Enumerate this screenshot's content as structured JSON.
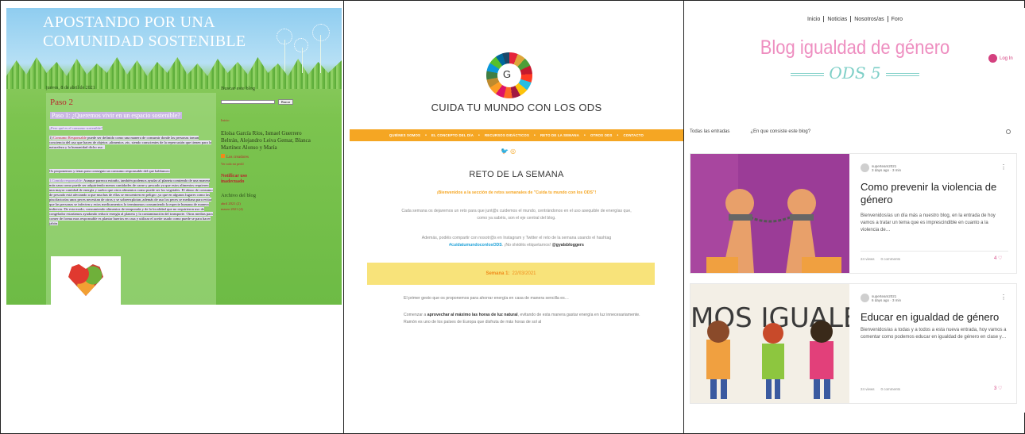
{
  "panel1": {
    "blog_title": "APOSTANDO POR UNA COMUNIDAD SOSTENIBLE",
    "date": "jueves, 8 de abril de 2021",
    "post_title": "Paso 2",
    "post_subtitle": "Paso 1: ¿Queremos vivir en un espacio sostenible?",
    "question": "¿Pero qué es el consumo sostenible?",
    "p1_label": "1)",
    "p1_red": "Consumo Responsable",
    "p1_text": "puede ser definido como una manera de consumir donde las personas toman conciencia del uso que hacen de objetos ,alimentos ,etc, siendo conscientes de la repercusión que tienen para la naturaleza y la humanidad dicho uso .",
    "p2_text": "Os proponemos y tenas para conseguir un consumo responsable del que hablamos:",
    "p3_red": "1.Comida responsable:",
    "p3_text": "Aunque parezca extraño, también podemos ayudar al planeta comiendo de una manera más sana como puede ser adquiriendo menos cantidades de carne y pescado ya que estos alimentos requieren una mayor cantidad de energía y suelos que otros alimentos como puede ser los vegetales. El abuso de consumo de pescado está afectando a que muchas de ellas se encuentren en peligro ,ya que en algunos lugares como las piscifactorías unos peces necesitan de otros y se sobreexplotan ,además de uso los peces se mediana para evitar que las personas se infecten y estos medicamentos lo terminamos consumiendo la especie humana de manera indirecta. De esta modo, consumiendo alimentos de temporada y de la localidad que no requirieron uso de congelador estaríamos ayudando reducir energía al planeta y la contaminación del transporte. Otras medias para comer de forma mas responsable es plantar huertos en casa y utilizar el aceite usado como puede se para hacer jabón.",
    "sidebar": {
      "search_heading": "Buscar este blog",
      "search_button": "Buscar",
      "home_link": "Inicio",
      "authors": "Eloísa García Ríos, Ismael Guerrero Beltrán, Alejandro Leiva Gemar, Blanca Martínez Alonso y María",
      "creators_link": "Los creadores",
      "profile_link": "Ver todo mi perfil",
      "notify_heading": "Notificar uso inadecuado",
      "archive_heading": "Archivo del blog",
      "archive_items": [
        "abril 2021 (2)",
        "marzo 2021 (4)"
      ]
    }
  },
  "panel2": {
    "logo_letter": "G",
    "brand": "CUIDA TU MUNDO CON LOS ODS",
    "nav": [
      "QUIÉNES SOMOS",
      "EL CONCEPTO DEL DÍA",
      "RECURSOS DIDÁCTICOS",
      "RETO DE LA SEMANA",
      "OTROS ODS",
      "CONTACTO"
    ],
    "nav_sep": "•",
    "social": "🐦 ◎",
    "heading": "RETO DE LA SEMANA",
    "welcome": "¡Bienvenidos a la sección de retos semanales de \"Cuida tu mundo con los ODS\"!",
    "intro": "Cada semana os dejaremos un reto para que junt@s cuidemos el mundo, centrándonos en el uso asequible de energías que, como ya sabéis, son el eje central del blog.",
    "share_text": "Además, podéis compartir con nosotr@s en Instagram y Twitter el reto de la semana usando el hashtag",
    "hashtag": "#cuidatumundoconlosODS",
    "share_tail": ". ¡No olvidéis etiquetarnos!",
    "handle": "@gyalsbloggers",
    "week_label": "Semana 1:",
    "week_date": "22/03/2021",
    "body1": "El primer gesto que os proponemos para ahorrar energía en casa de manera sencilla es…",
    "body2_a": "Comenzar a",
    "body2_b": "aprovechar al máximo las horas de luz natural",
    "body2_c": ", evitando de esta manera gastar energía en luz innecesariamente. Ramón es uno de los países de Europa que disfruta de más horas de sol al"
  },
  "panel3": {
    "nav": [
      "Inicio",
      "Noticias",
      "Nosotros/as",
      "Foro"
    ],
    "title": "Blog igualdad de género",
    "subtitle": "ODS 5",
    "login": "Log In",
    "filters": [
      "Todas las entradas",
      "¿En que consiste este blog?"
    ],
    "posts": [
      {
        "author": "superteam2021",
        "meta": "3 days ago · 3 min",
        "title": "Como prevenir la violencia de género",
        "excerpt": "Bienvenidos/as un día más a nuestro blog, en la entrada de hoy vamos a tratar un tema que es imprescindible en cuanto a la violencia de…",
        "views": "24 views",
        "comments": "0 comments",
        "likes": "4 ♡"
      },
      {
        "author": "superteam2021",
        "meta": "6 days ago · 3 min",
        "title": "Educar en igualdad de género",
        "excerpt": "Bienvenidos/as a todas y a todos a esta nueva entrada, hoy vamos a comentar como podemos educar en igualdad de género en clase y…",
        "views": "24 views",
        "comments": "0 comments",
        "likes": "3 ♡",
        "image_text": "MOS IGUALE"
      }
    ]
  }
}
